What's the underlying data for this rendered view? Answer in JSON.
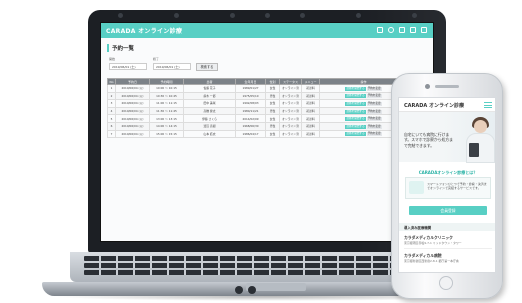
{
  "laptop": {
    "app": {
      "logo": "CARADA オンライン診療",
      "page_title": "予約一覧",
      "filters": {
        "from_label": "開始",
        "from_value": "2019/06/01 (土)",
        "to_label": "終了",
        "to_value": "2019/06/01 (土)",
        "search_button": "検索する"
      },
      "table": {
        "columns": [
          "No",
          "予約日",
          "予約時間",
          "患者",
          "生年月日",
          "性別",
          "ステータス",
          "メニュー",
          "操作"
        ],
        "rows": [
          [
            "1",
            "2019/06/04 (火)",
            "10:00 〜 10:15",
            "佐藤 花子",
            "1989/01/27",
            "女性",
            "オンライン済",
            "初診料"
          ],
          [
            "2",
            "2019/06/04 (火)",
            "10:30 〜 10:45",
            "鈴木 一郎",
            "1975/05/10",
            "男性",
            "オンライン済",
            "初診料"
          ],
          [
            "3",
            "2019/06/04 (火)",
            "11:00 〜 11:15",
            "田中 美咲",
            "1992/08/03",
            "女性",
            "オンライン済",
            "初診料"
          ],
          [
            "4",
            "2019/06/04 (火)",
            "11:30 〜 11:45",
            "高橋 健太",
            "1980/11/21",
            "男性",
            "オンライン済",
            "初診料"
          ],
          [
            "5",
            "2019/06/04 (火)",
            "13:00 〜 13:15",
            "伊藤 さくら",
            "2014/02/09",
            "女性",
            "オンライン済",
            "初診料"
          ],
          [
            "6",
            "2019/06/04 (火)",
            "14:00 〜 14:15",
            "渡辺 直樹",
            "1968/06/30",
            "男性",
            "オンライン済",
            "初診料"
          ],
          [
            "7",
            "2019/06/04 (火)",
            "15:00 〜 15:15",
            "山本 結衣",
            "1986/04/17",
            "女性",
            "オンライン済",
            "初診料"
          ]
        ],
        "action_primary": "診療を開始する",
        "action_secondary": "予約を変更"
      }
    }
  },
  "phone": {
    "logo": "CARADA オンライン診療",
    "hero_text": "自宅にいても病院に行けます。スマホで診察から処方まで完結できます。",
    "section_title": "CARADAオンライン診療とは？",
    "card_text": "スマートフォンひとつで予約・診察・決済までオンラインで完結するサービスです。",
    "cta_button": "会員登録",
    "subhead": "導入済み医療機関",
    "clinics": [
      {
        "name": "カラダメディカルクリニック",
        "address": "東京都港区赤坂9-7-1 ミッドタウン・タワー"
      },
      {
        "name": "カラダメディカル病院",
        "address": "東京都新宿区西新宿2-8-1 都庁第一本庁舎"
      }
    ]
  },
  "colors": {
    "accent": "#58cfc4",
    "header_gray": "#7c8288",
    "laptop_body": "#1c1f24"
  },
  "icons": [
    "camera-icon",
    "menu-icon",
    "person-photo",
    "home-button-icon"
  ]
}
